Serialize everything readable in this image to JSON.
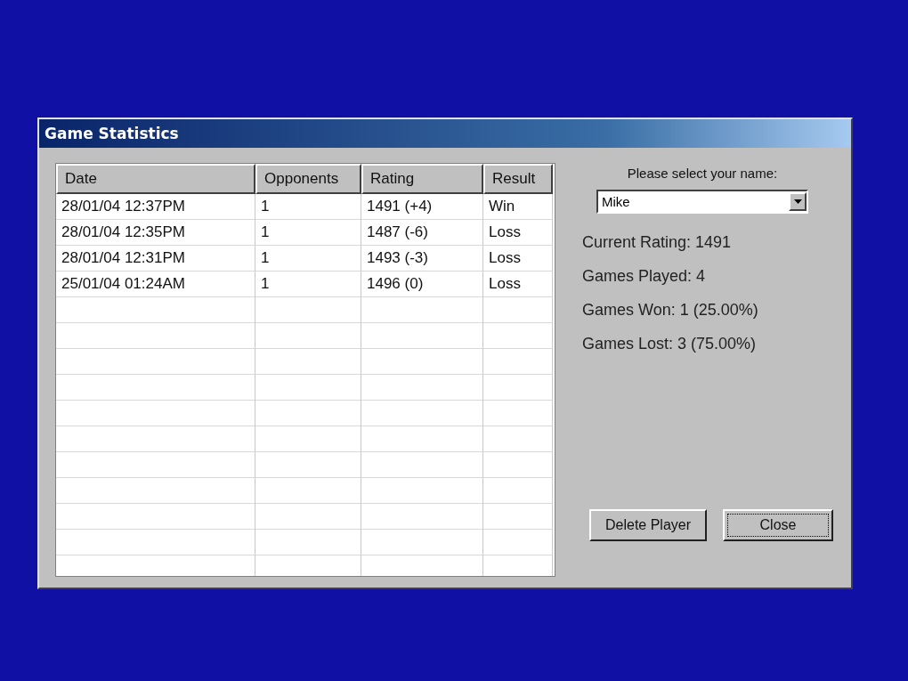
{
  "window": {
    "title": "Game Statistics"
  },
  "table": {
    "columns": [
      "Date",
      "Opponents",
      "Rating",
      "Result"
    ],
    "rows": [
      [
        "28/01/04 12:37PM",
        "1",
        "1491 (+4)",
        "Win"
      ],
      [
        "28/01/04 12:35PM",
        "1",
        "1487 (-6)",
        "Loss"
      ],
      [
        "28/01/04 12:31PM",
        "1",
        "1493 (-3)",
        "Loss"
      ],
      [
        "25/01/04 01:24AM",
        "1",
        "1496 (0)",
        "Loss"
      ]
    ]
  },
  "player_select": {
    "label": "Please select your name:",
    "value": "Mike"
  },
  "stats": [
    "Current Rating: 1491",
    "Games Played: 4",
    "Games Won: 1 (25.00%)",
    "Games Lost: 3 (75.00%)"
  ],
  "buttons": [
    {
      "label": "Delete Player",
      "focused": false
    },
    {
      "label": "Close",
      "focused": true
    }
  ]
}
